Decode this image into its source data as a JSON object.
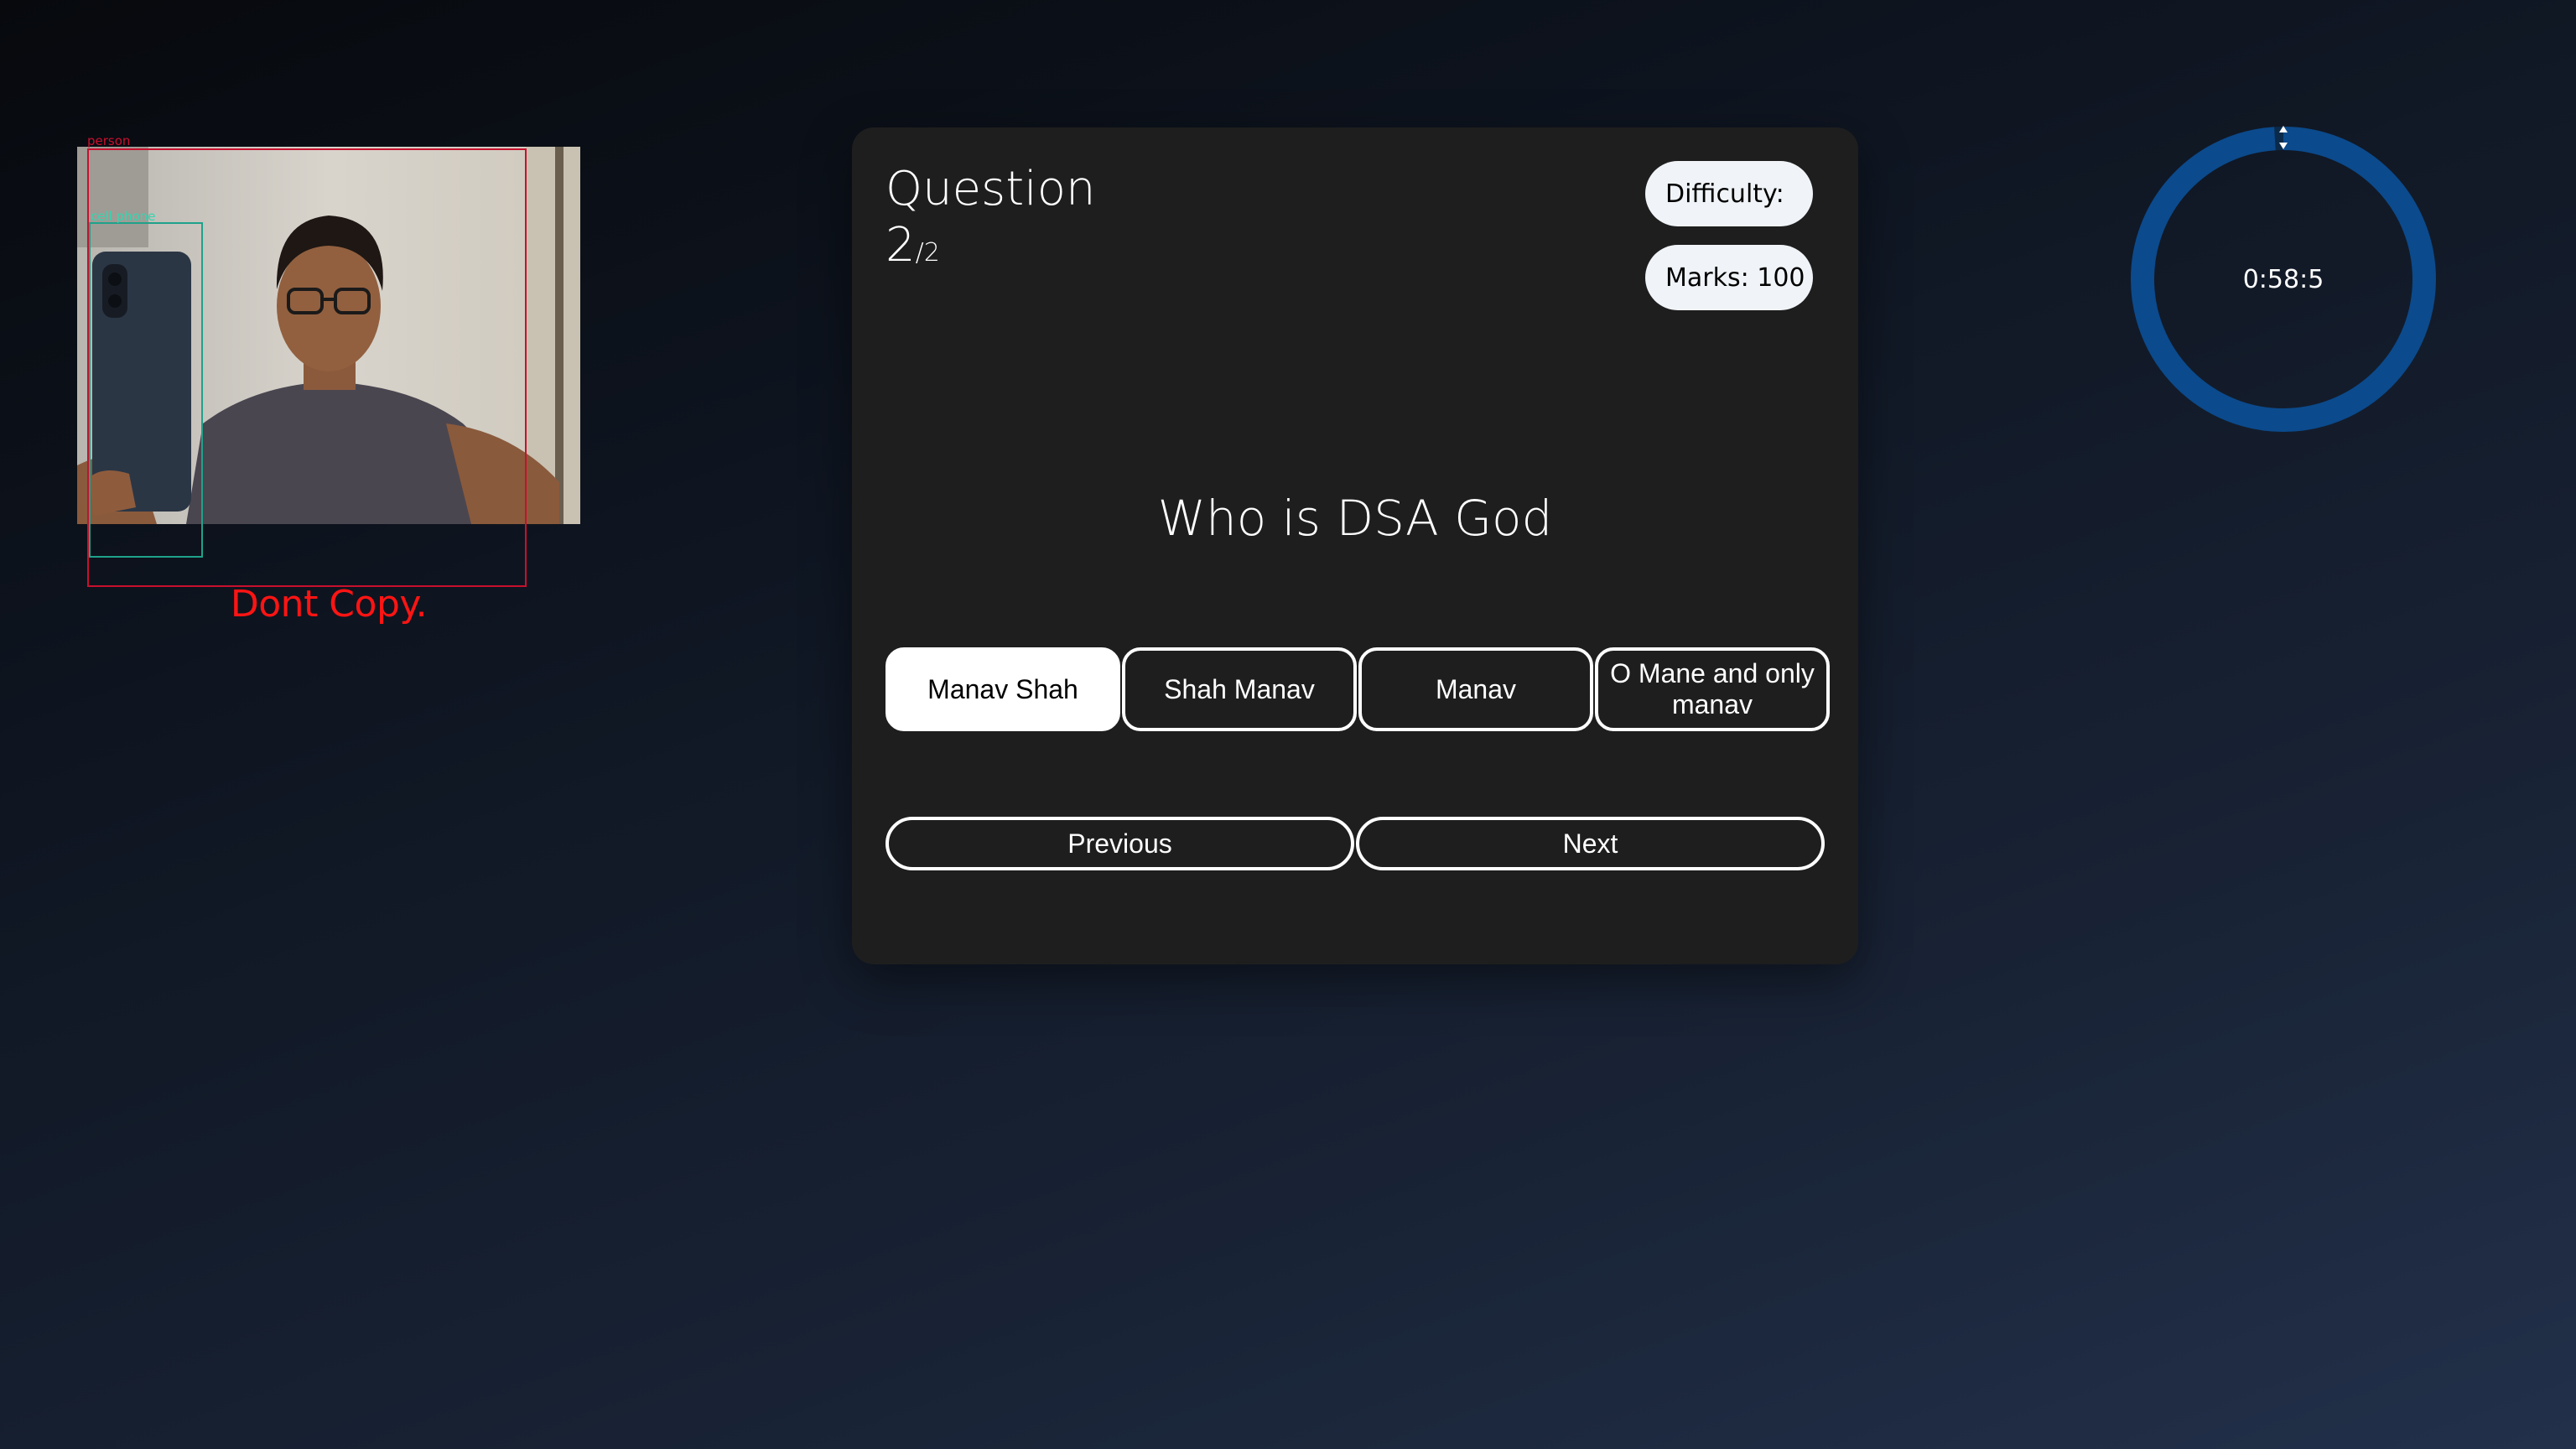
{
  "proctor": {
    "detections": {
      "person_label": "person",
      "phone_label": "cell phone"
    },
    "warning": "Dont Copy."
  },
  "question": {
    "label": "Question",
    "current": "2",
    "total": "2",
    "text": "Who is DSA God",
    "difficulty_label": "Difficulty:",
    "marks_label": "Marks: 100"
  },
  "options": [
    {
      "label": "Manav Shah",
      "selected": true
    },
    {
      "label": "Shah Manav",
      "selected": false
    },
    {
      "label": "Manav",
      "selected": false
    },
    {
      "label": "O Mane and only manav",
      "selected": false
    }
  ],
  "navigation": {
    "previous": "Previous",
    "next": "Next"
  },
  "timer": {
    "display": "0:58:5",
    "remaining_fraction": 0.99,
    "ring_color": "#0b4a8c"
  },
  "colors": {
    "warning": "#ff1414",
    "person_box": "#c8102e",
    "phone_box": "#1ea28a",
    "card": "#1e1e1e"
  }
}
